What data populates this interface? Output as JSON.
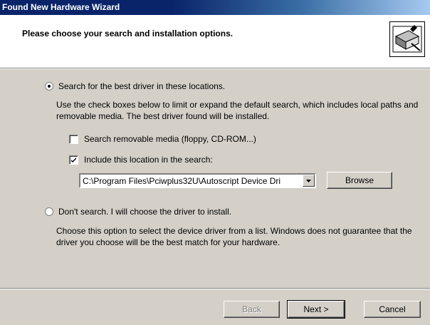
{
  "window": {
    "title": "Found New Hardware Wizard"
  },
  "header": {
    "heading": "Please choose your search and installation options.",
    "icon": "hardware-wizard-icon"
  },
  "options": {
    "search": {
      "label": "Search for the best driver in these locations.",
      "selected": true,
      "description": "Use the check boxes below to limit or expand the default search, which includes local paths and removable media. The best driver found will be installed."
    },
    "removable_media": {
      "label": "Search removable media (floppy, CD-ROM...)",
      "checked": false
    },
    "include_location": {
      "label": "Include this location in the search:",
      "checked": true
    },
    "location_path": "C:\\Program Files\\Pciwplus32U\\Autoscript Device Dri",
    "browse_label": "Browse",
    "dont_search": {
      "label": "Don't search. I will choose the driver to install.",
      "selected": false,
      "description": "Choose this option to select the device driver from a list.  Windows does not guarantee that the driver you choose will be the best match for your hardware."
    }
  },
  "footer": {
    "back_label": "Back",
    "next_label": "Next >",
    "cancel_label": "Cancel"
  }
}
